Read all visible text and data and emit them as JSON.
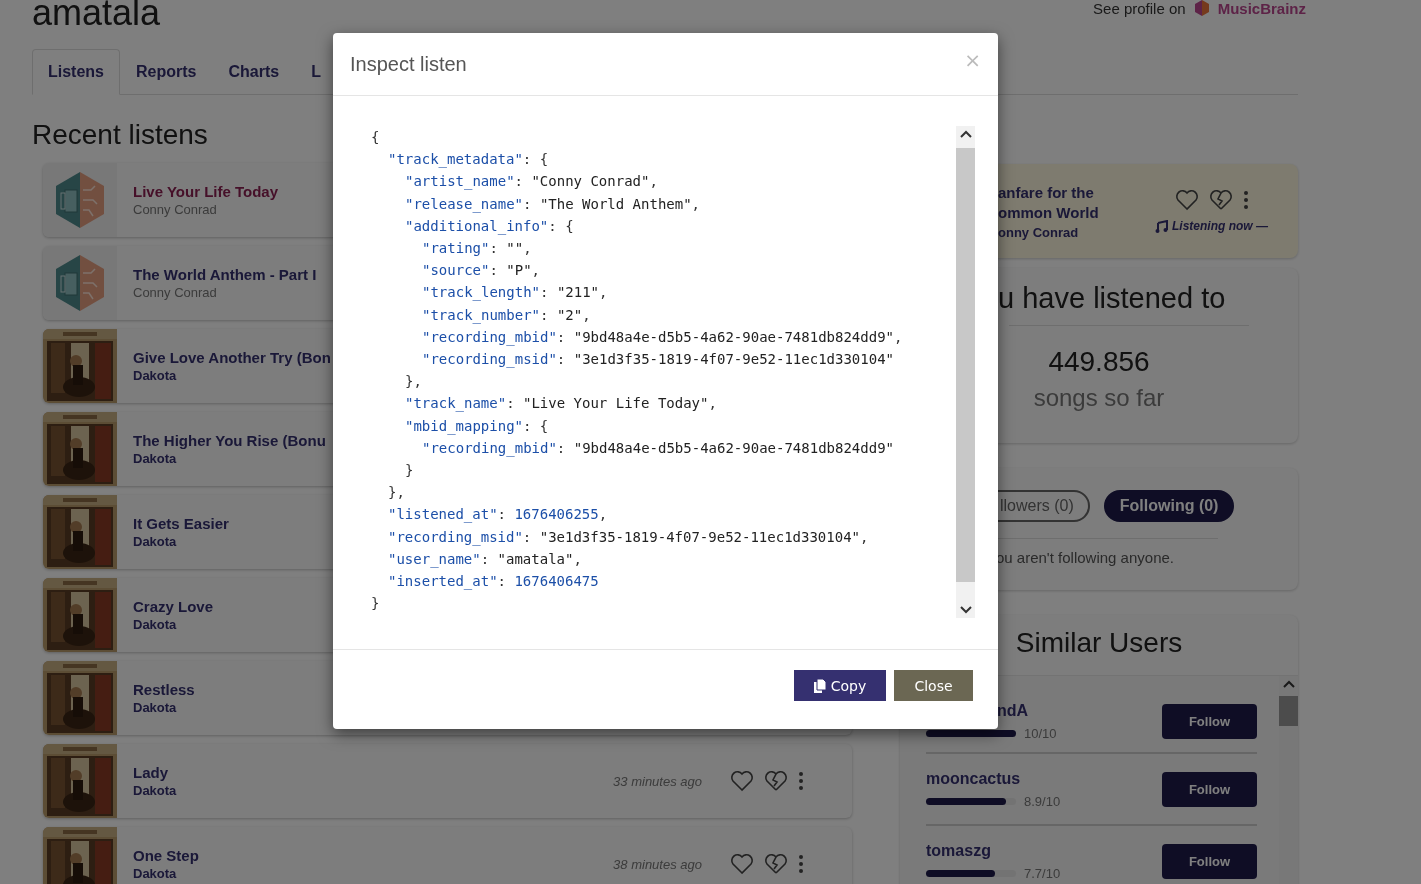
{
  "profile": {
    "username": "amatala",
    "see_profile": "See profile on",
    "musicbrainz": "MusicBrainz"
  },
  "tabs": [
    {
      "label": "Listens",
      "selected": true
    },
    {
      "label": "Reports",
      "selected": false
    },
    {
      "label": "Charts",
      "selected": false
    },
    {
      "label": "L",
      "selected": false
    }
  ],
  "recent_listens": {
    "heading": "Recent listens",
    "items": [
      {
        "title": "Live Your Life Today",
        "artist": "Conny Conrad",
        "kind": "placeholder",
        "selected": true
      },
      {
        "title": "The World Anthem - Part I",
        "artist": "Conny Conrad",
        "kind": "placeholder",
        "selected": false
      },
      {
        "title": "Give Love Another Try (Bon",
        "artist": "Dakota",
        "kind": "picture",
        "selected": false
      },
      {
        "title": "The Higher You Rise (Bonu",
        "artist": "Dakota",
        "kind": "picture",
        "selected": false
      },
      {
        "title": "It Gets Easier",
        "artist": "Dakota",
        "kind": "picture",
        "selected": false
      },
      {
        "title": "Crazy Love",
        "artist": "Dakota",
        "kind": "picture",
        "selected": false
      },
      {
        "title": "Restless",
        "artist": "Dakota",
        "kind": "picture",
        "selected": false
      },
      {
        "title": "Lady",
        "artist": "Dakota",
        "kind": "picture",
        "selected": false,
        "time": "33 minutes ago"
      },
      {
        "title": "One Step",
        "artist": "Dakota",
        "kind": "picture",
        "selected": false,
        "time": "38 minutes ago"
      }
    ]
  },
  "now_playing": {
    "title_lines": [
      "anfare for the",
      "ommon World"
    ],
    "artist": "onny Conrad",
    "status": "Listening now —"
  },
  "stats": {
    "heading": "u have listened to",
    "count": "449.856",
    "caption": "songs so far"
  },
  "follow": {
    "tabs": [
      {
        "label": "llowers (0)",
        "selected": false
      },
      {
        "label": "Following (0)",
        "selected": true
      }
    ],
    "message": "ou aren't following anyone."
  },
  "similar_users": {
    "heading": "Similar Users",
    "users": [
      {
        "name": "ndA",
        "level": 1.0,
        "score": "10/10",
        "button": "Follow"
      },
      {
        "name": "mooncactus",
        "level": 0.89,
        "score": "8.9/10",
        "button": "Follow"
      },
      {
        "name": "tomaszg",
        "level": 0.77,
        "score": "7.7/10",
        "button": "Follow"
      }
    ]
  },
  "modal": {
    "title": "Inspect listen",
    "close": "×",
    "copy": "Copy",
    "dismiss": "Close",
    "code": {
      "open": [
        {
          "kind": "punct",
          "text": "{"
        }
      ],
      "close": [
        {
          "kind": "punct",
          "text": "}"
        }
      ],
      "children": [
        {
          "open": [
            {
              "kind": "key",
              "text": "\"track_metadata\""
            },
            {
              "kind": "punct",
              "text": ": {"
            }
          ],
          "close": [
            {
              "kind": "punct",
              "text": "},"
            }
          ],
          "children": [
            {
              "open": [
                {
                  "kind": "key",
                  "text": "\"artist_name\""
                },
                {
                  "kind": "punct",
                  "text": ": "
                },
                {
                  "kind": "string",
                  "text": "\"Conny Conrad\""
                },
                {
                  "kind": "punct",
                  "text": ","
                }
              ]
            },
            {
              "open": [
                {
                  "kind": "key",
                  "text": "\"release_name\""
                },
                {
                  "kind": "punct",
                  "text": ": "
                },
                {
                  "kind": "string",
                  "text": "\"The World Anthem\""
                },
                {
                  "kind": "punct",
                  "text": ","
                }
              ]
            },
            {
              "open": [
                {
                  "kind": "key",
                  "text": "\"additional_info\""
                },
                {
                  "kind": "punct",
                  "text": ": {"
                }
              ],
              "close": [
                {
                  "kind": "punct",
                  "text": "},"
                }
              ],
              "children": [
                {
                  "open": [
                    {
                      "kind": "key",
                      "text": "\"rating\""
                    },
                    {
                      "kind": "punct",
                      "text": ": "
                    },
                    {
                      "kind": "string",
                      "text": "\"\""
                    },
                    {
                      "kind": "punct",
                      "text": ","
                    }
                  ]
                },
                {
                  "open": [
                    {
                      "kind": "key",
                      "text": "\"source\""
                    },
                    {
                      "kind": "punct",
                      "text": ": "
                    },
                    {
                      "kind": "string",
                      "text": "\"P\""
                    },
                    {
                      "kind": "punct",
                      "text": ","
                    }
                  ]
                },
                {
                  "open": [
                    {
                      "kind": "key",
                      "text": "\"track_length\""
                    },
                    {
                      "kind": "punct",
                      "text": ": "
                    },
                    {
                      "kind": "string",
                      "text": "\"211\""
                    },
                    {
                      "kind": "punct",
                      "text": ","
                    }
                  ]
                },
                {
                  "open": [
                    {
                      "kind": "key",
                      "text": "\"track_number\""
                    },
                    {
                      "kind": "punct",
                      "text": ": "
                    },
                    {
                      "kind": "string",
                      "text": "\"2\""
                    },
                    {
                      "kind": "punct",
                      "text": ","
                    }
                  ]
                },
                {
                  "open": [
                    {
                      "kind": "key",
                      "text": "\"recording_mbid\""
                    },
                    {
                      "kind": "punct",
                      "text": ": "
                    },
                    {
                      "kind": "string",
                      "text": "\"9bd48a4e-d5b5-4a62-90ae-7481db824dd9\""
                    },
                    {
                      "kind": "punct",
                      "text": ","
                    }
                  ]
                },
                {
                  "open": [
                    {
                      "kind": "key",
                      "text": "\"recording_msid\""
                    },
                    {
                      "kind": "punct",
                      "text": ": "
                    },
                    {
                      "kind": "string",
                      "text": "\"3e1d3f35-1819-4f07-9e52-11ec1d330104\""
                    }
                  ]
                }
              ]
            },
            {
              "open": [
                {
                  "kind": "key",
                  "text": "\"track_name\""
                },
                {
                  "kind": "punct",
                  "text": ": "
                },
                {
                  "kind": "string",
                  "text": "\"Live Your Life Today\""
                },
                {
                  "kind": "punct",
                  "text": ","
                }
              ]
            },
            {
              "open": [
                {
                  "kind": "key",
                  "text": "\"mbid_mapping\""
                },
                {
                  "kind": "punct",
                  "text": ": {"
                }
              ],
              "close": [
                {
                  "kind": "punct",
                  "text": "}"
                }
              ],
              "children": [
                {
                  "open": [
                    {
                      "kind": "key",
                      "text": "\"recording_mbid\""
                    },
                    {
                      "kind": "punct",
                      "text": ": "
                    },
                    {
                      "kind": "string",
                      "text": "\"9bd48a4e-d5b5-4a62-90ae-7481db824dd9\""
                    }
                  ]
                }
              ]
            }
          ]
        },
        {
          "open": [
            {
              "kind": "key",
              "text": "\"listened_at\""
            },
            {
              "kind": "punct",
              "text": ": "
            },
            {
              "kind": "number",
              "text": "1676406255"
            },
            {
              "kind": "punct",
              "text": ","
            }
          ]
        },
        {
          "open": [
            {
              "kind": "key",
              "text": "\"recording_msid\""
            },
            {
              "kind": "punct",
              "text": ": "
            },
            {
              "kind": "string",
              "text": "\"3e1d3f35-1819-4f07-9e52-11ec1d330104\""
            },
            {
              "kind": "punct",
              "text": ","
            }
          ]
        },
        {
          "open": [
            {
              "kind": "key",
              "text": "\"user_name\""
            },
            {
              "kind": "punct",
              "text": ": "
            },
            {
              "kind": "string",
              "text": "\"amatala\""
            },
            {
              "kind": "punct",
              "text": ","
            }
          ]
        },
        {
          "open": [
            {
              "kind": "key",
              "text": "\"inserted_at\""
            },
            {
              "kind": "punct",
              "text": ": "
            },
            {
              "kind": "number",
              "text": "1676406475"
            }
          ]
        }
      ]
    }
  }
}
